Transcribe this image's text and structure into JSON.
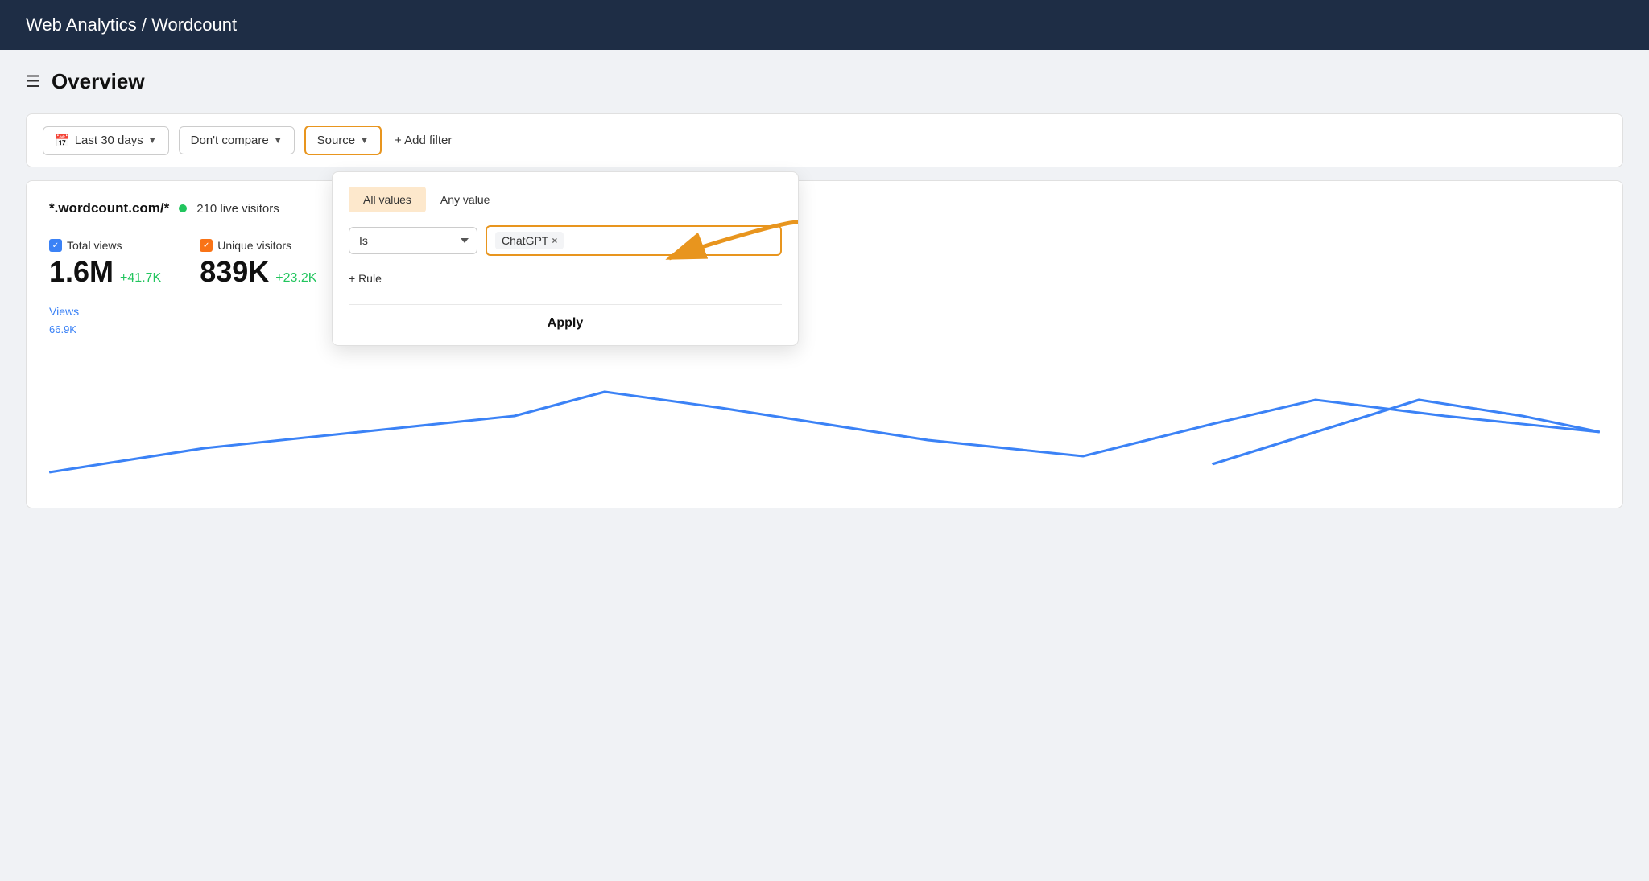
{
  "topbar": {
    "title": "Web Analytics / Wordcount"
  },
  "overview": {
    "title": "Overview"
  },
  "filters": {
    "date_range_label": "Last 30 days",
    "compare_label": "Don't compare",
    "source_label": "Source",
    "add_filter_label": "+ Add filter"
  },
  "site": {
    "name": "*.wordcount.com/*",
    "live_visitors": "210 live visitors"
  },
  "stats": [
    {
      "label": "Total views",
      "value": "1.6M",
      "delta": "+41.7K",
      "type": "blue"
    },
    {
      "label": "Unique visitors",
      "value": "839K",
      "delta": "+23.2K",
      "type": "orange"
    }
  ],
  "views_link": "Views",
  "views_subval": "66.9K",
  "dropdown": {
    "tab_all_values": "All values",
    "tab_any_value": "Any value",
    "is_select_value": "Is",
    "tag_value": "ChatGPT",
    "add_rule_label": "+ Rule",
    "apply_label": "Apply"
  },
  "colors": {
    "topbar_bg": "#1e2d45",
    "accent_orange": "#e8951e",
    "blue": "#3b82f6",
    "green": "#22c55e"
  }
}
